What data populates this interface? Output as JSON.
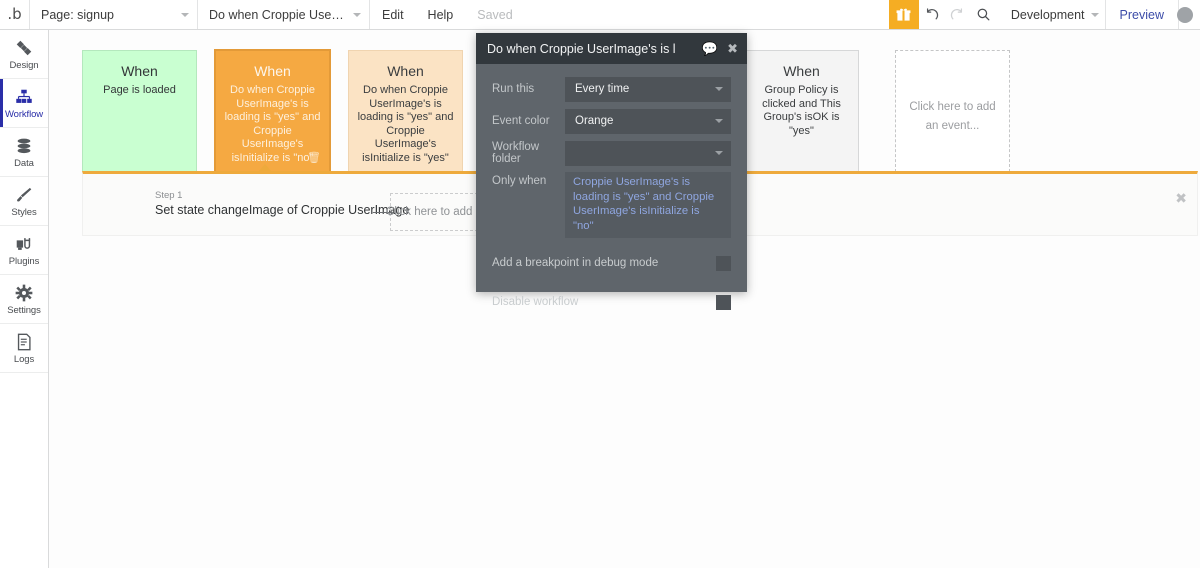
{
  "topbar": {
    "logo": "logo-b",
    "page_selector": {
      "label": "Page: signup",
      "icon": "chevron-down-icon"
    },
    "workflow_selector": {
      "label": "Do when Croppie UserImage's is...",
      "icon": "chevron-down-icon"
    },
    "edit_label": "Edit",
    "help_label": "Help",
    "saved_label": "Saved",
    "gift_icon": "gift-icon",
    "undo_icon": "undo-icon",
    "redo_icon": "redo-icon",
    "search_icon": "search-icon",
    "environment": {
      "label": "Development",
      "icon": "chevron-down-icon"
    },
    "preview_label": "Preview",
    "avatar": "user-avatar",
    "accent_gift": "#f5ad23",
    "accent_preview": "#3c4ca8"
  },
  "sidebar": {
    "items": [
      {
        "label": "Design",
        "icon": "design-icon",
        "active": false
      },
      {
        "label": "Workflow",
        "icon": "workflow-icon",
        "active": true
      },
      {
        "label": "Data",
        "icon": "database-icon",
        "active": false
      },
      {
        "label": "Styles",
        "icon": "brush-icon",
        "active": false
      },
      {
        "label": "Plugins",
        "icon": "plugins-icon",
        "active": false
      },
      {
        "label": "Settings",
        "icon": "gear-icon",
        "active": false
      },
      {
        "label": "Logs",
        "icon": "logs-icon",
        "active": false
      }
    ],
    "active_color": "#2a2ea8",
    "collapse_icon": "chevron-right-icon"
  },
  "canvas": {
    "event_cards": [
      {
        "when_label": "When",
        "description": "Page is loaded",
        "color": "#c9ffd1",
        "style": "green",
        "selected": false
      },
      {
        "when_label": "When",
        "description": "Do when Croppie UserImage's is loading is \"yes\" and Croppie UserImage's isInitialize is \"no\"",
        "color": "#f5a942",
        "style": "orange",
        "selected": true,
        "delete_icon": "trash-icon"
      },
      {
        "when_label": "When",
        "description": "Do when Croppie UserImage's is loading is \"yes\" and Croppie UserImage's isInitialize is \"yes\"",
        "color": "#fbe3c4",
        "style": "lightorange",
        "selected": false
      },
      {
        "when_label": "When",
        "description": "Group Policy is clicked and This Group's isOK is \"yes\"",
        "color": "#f4f4f4",
        "style": "gray",
        "selected": false
      },
      {
        "when_label": "",
        "description": "Click here to add an event...",
        "style": "empty",
        "selected": false
      }
    ],
    "action_band": {
      "accent_color": "#eeaa3c",
      "step_label": "Step 1",
      "step_title": "Set state changeImage of Croppie UserImage",
      "arrow_icon": "arrow-right-icon",
      "add_action_label": "Click here to add an action...",
      "close_icon": "close-icon"
    }
  },
  "dialog": {
    "title": "Do when Croppie UserImage's is l",
    "comment_icon": "comment-icon",
    "close_icon": "close-icon",
    "header_color": "#32383d",
    "body_color": "#5f656b",
    "fields": [
      {
        "label": "Run this",
        "value": "Every time",
        "icon": "chevron-down-icon"
      },
      {
        "label": "Event color",
        "value": "Orange",
        "icon": "chevron-down-icon"
      },
      {
        "label": "Workflow folder",
        "value": "",
        "icon": "chevron-down-icon"
      }
    ],
    "only_when": {
      "label": "Only when",
      "expression": "Croppie UserImage's is loading is \"yes\" and Croppie UserImage's isInitialize is \"no\"",
      "expression_color": "#8fa6e0"
    },
    "toggles": [
      {
        "label": "Add a breakpoint in debug mode",
        "checked": false
      },
      {
        "label": "Disable workflow",
        "checked": false
      }
    ]
  }
}
